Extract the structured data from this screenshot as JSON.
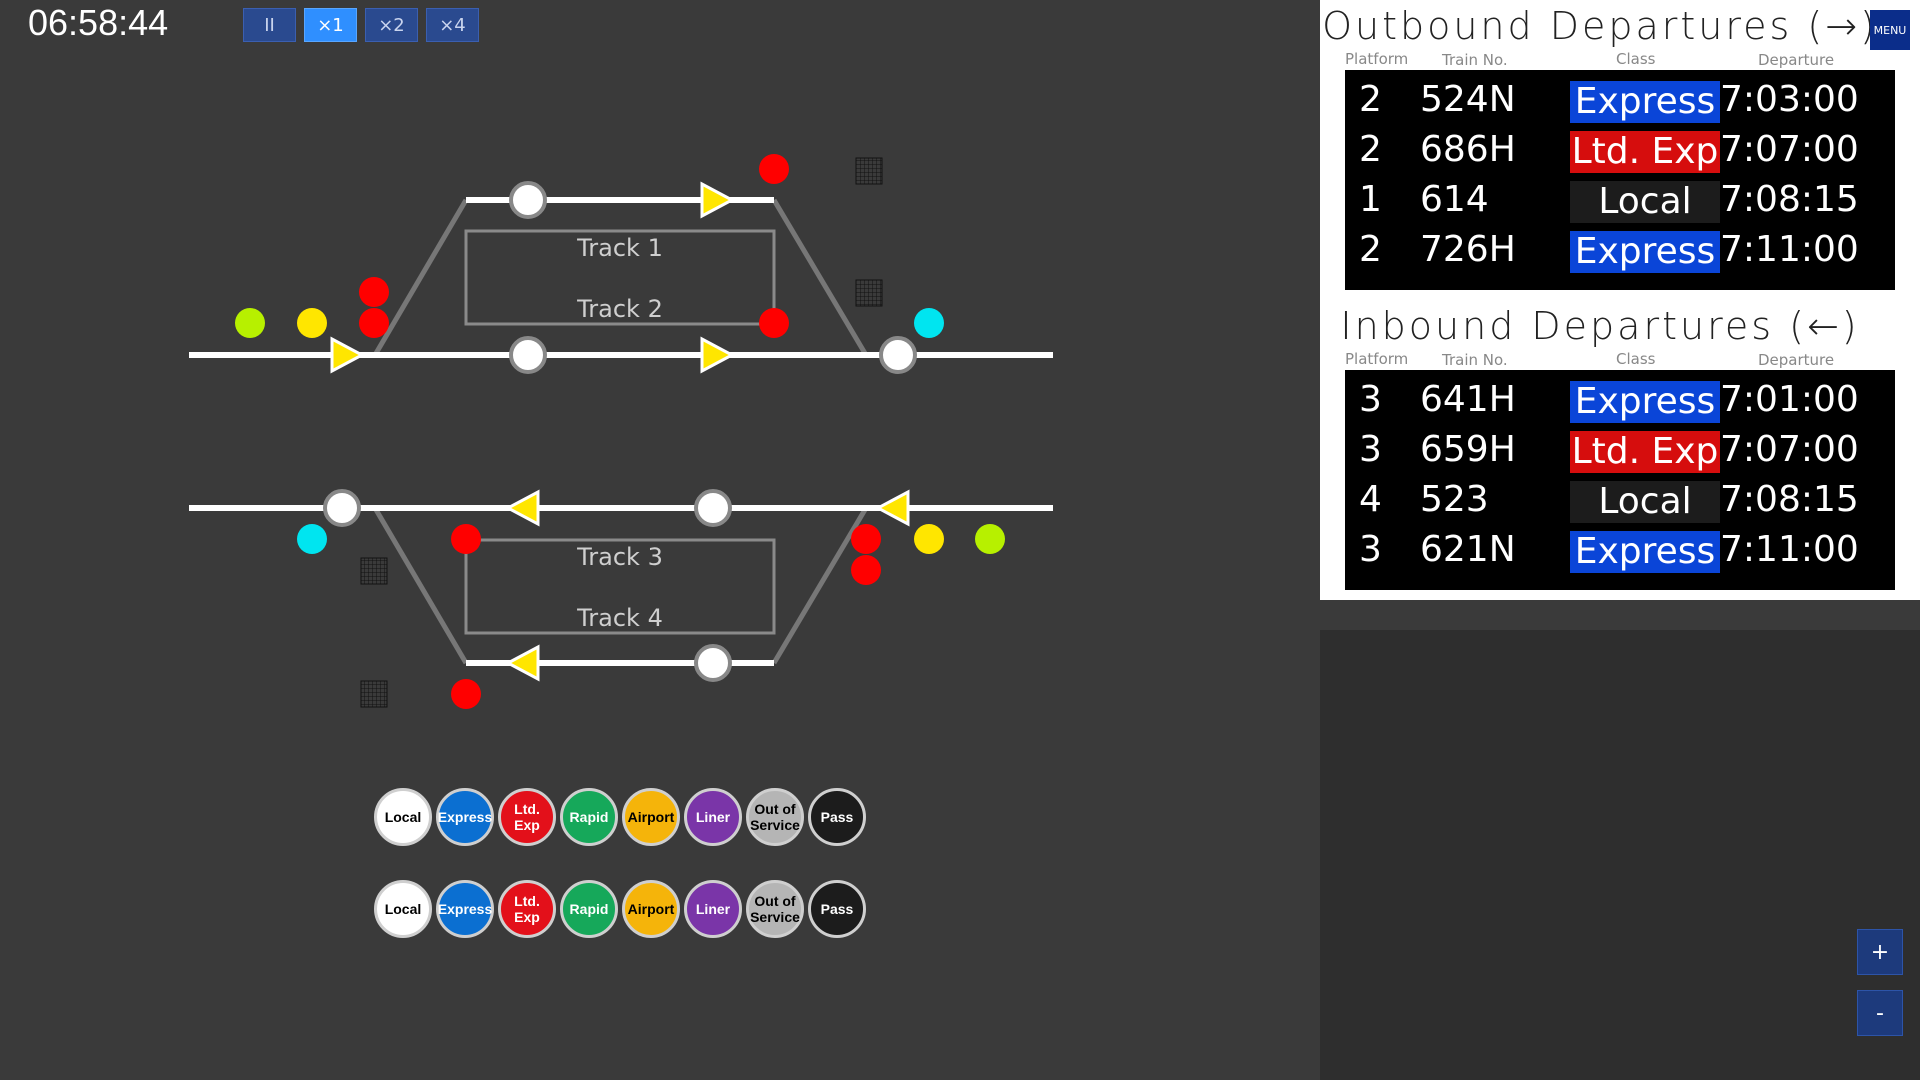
{
  "clock": "06:58:44",
  "speed_controls": [
    "II",
    "×1",
    "×2",
    "×4"
  ],
  "active_speed": "×1",
  "track_labels": [
    "Track 1",
    "Track 2",
    "Track 3",
    "Track 4"
  ],
  "legend": [
    {
      "label": "Local",
      "bg": "#ffffff",
      "fg": "#000000"
    },
    {
      "label": "Express",
      "bg": "#0b6fd1",
      "fg": "#ffffff"
    },
    {
      "label": "Ltd. Exp",
      "bg": "#e3101a",
      "fg": "#ffffff"
    },
    {
      "label": "Rapid",
      "bg": "#16a85a",
      "fg": "#ffffff"
    },
    {
      "label": "Airport",
      "bg": "#f5b40a",
      "fg": "#000000"
    },
    {
      "label": "Liner",
      "bg": "#7a35a8",
      "fg": "#ffffff"
    },
    {
      "label": "Out of\nService",
      "bg": "#b5b5b5",
      "fg": "#000000"
    },
    {
      "label": "Pass",
      "bg": "#1c1c1c",
      "fg": "#ffffff"
    }
  ],
  "outbound": {
    "title": "Outbound Departures (→)",
    "headers": [
      "Platform",
      "Train No.",
      "Class",
      "Departure"
    ],
    "rows": [
      {
        "platform": "2",
        "train": "524N",
        "class": "Express",
        "time": "7:03:00"
      },
      {
        "platform": "2",
        "train": "686H",
        "class": "Ltd. Exp",
        "time": "7:07:00"
      },
      {
        "platform": "1",
        "train": "614",
        "class": "Local",
        "time": "7:08:15"
      },
      {
        "platform": "2",
        "train": "726H",
        "class": "Express",
        "time": "7:11:00"
      }
    ]
  },
  "inbound": {
    "title": "Inbound Departures (←)",
    "headers": [
      "Platform",
      "Train No.",
      "Class",
      "Departure"
    ],
    "rows": [
      {
        "platform": "3",
        "train": "641H",
        "class": "Express",
        "time": "7:01:00"
      },
      {
        "platform": "3",
        "train": "659H",
        "class": "Ltd. Exp",
        "time": "7:07:00"
      },
      {
        "platform": "4",
        "train": "523",
        "class": "Local",
        "time": "7:08:15"
      },
      {
        "platform": "3",
        "train": "621N",
        "class": "Express",
        "time": "7:11:00"
      }
    ]
  },
  "menu_label": "MENU",
  "zoom_in": "+",
  "zoom_out": "-",
  "colors": {
    "signal_red": "#ff0000",
    "signal_yellow": "#ffe600",
    "signal_green": "#b7f000",
    "signal_cyan": "#00e5f0",
    "track": "#ffffff",
    "background": "#3a3a3a"
  }
}
